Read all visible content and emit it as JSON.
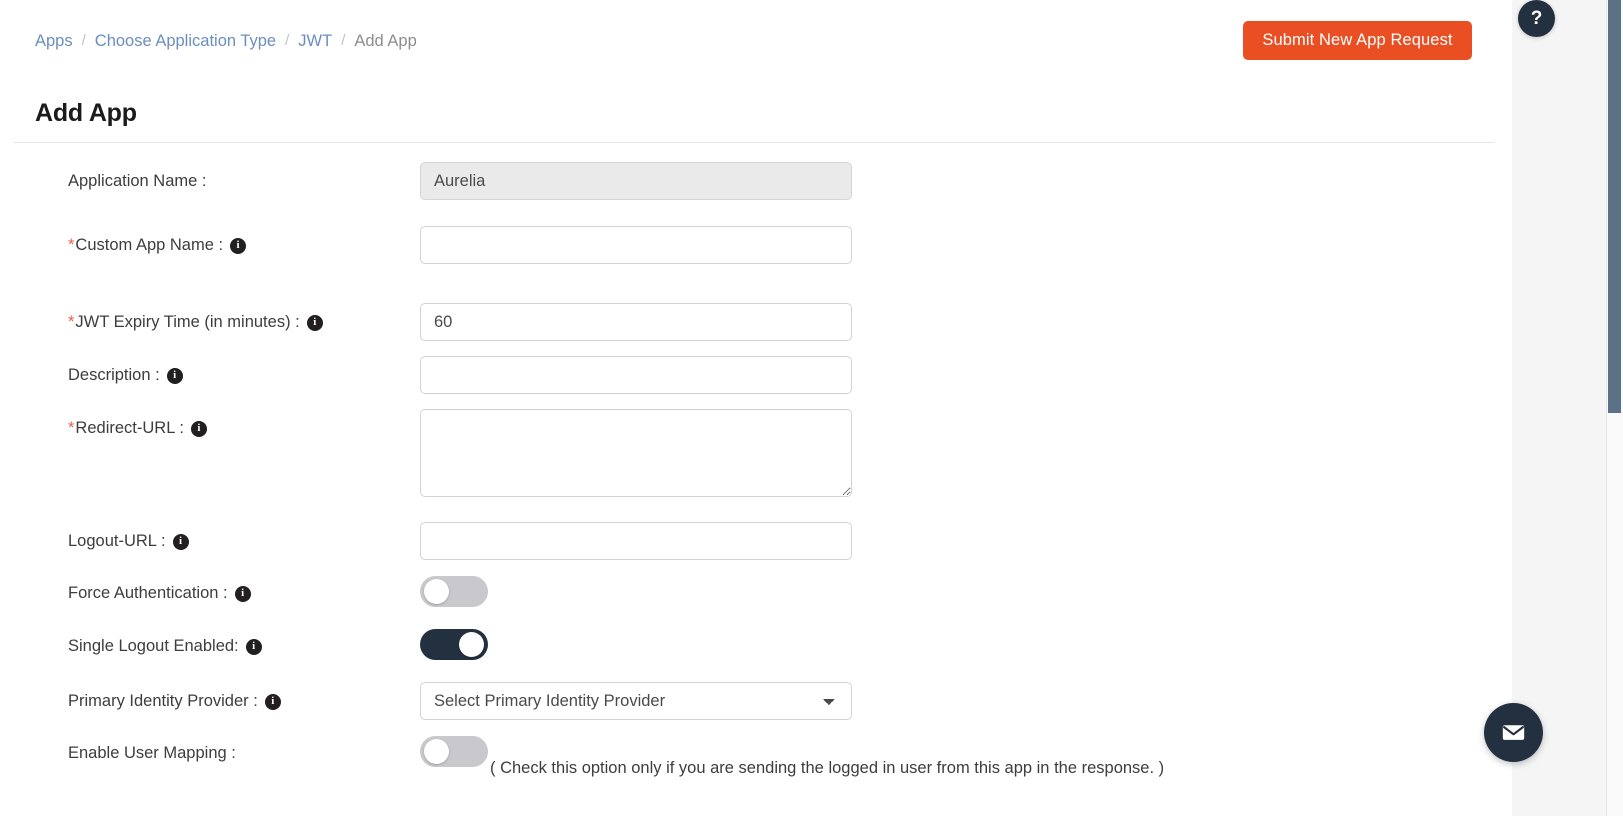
{
  "breadcrumb": {
    "items": [
      {
        "label": "Apps",
        "current": false
      },
      {
        "label": "Choose Application Type",
        "current": false
      },
      {
        "label": "JWT",
        "current": false
      },
      {
        "label": "Add App",
        "current": true
      }
    ],
    "separator": "/"
  },
  "header": {
    "title": "Add App",
    "submit_button": "Submit New App Request"
  },
  "form": {
    "fields": [
      {
        "label": "Application Name :",
        "required": false,
        "has_info_icon": false,
        "type": "text",
        "value": "Aurelia",
        "disabled": true
      },
      {
        "label": "Custom App Name :",
        "required": true,
        "has_info_icon": true,
        "type": "text",
        "value": "",
        "disabled": false
      },
      {
        "label": "JWT Expiry Time (in minutes) :",
        "required": true,
        "has_info_icon": true,
        "type": "text",
        "value": "60",
        "disabled": false
      },
      {
        "label": "Description :",
        "required": false,
        "has_info_icon": true,
        "type": "text",
        "value": "",
        "disabled": false
      },
      {
        "label": "Redirect-URL :",
        "required": true,
        "has_info_icon": true,
        "type": "textarea",
        "value": "",
        "disabled": false
      },
      {
        "label": "Logout-URL :",
        "required": false,
        "has_info_icon": true,
        "type": "text",
        "value": "",
        "disabled": false
      },
      {
        "label": "Force Authentication :",
        "required": false,
        "has_info_icon": true,
        "type": "toggle",
        "enabled": false
      },
      {
        "label": "Single Logout Enabled:",
        "required": false,
        "has_info_icon": true,
        "type": "toggle",
        "enabled": true
      },
      {
        "label": "Primary Identity Provider :",
        "required": false,
        "has_info_icon": true,
        "type": "select",
        "selected": "Select Primary Identity Provider"
      },
      {
        "label": "Enable User Mapping :",
        "required": false,
        "has_info_icon": false,
        "type": "toggle",
        "enabled": false,
        "helper": "( Check this option only if you are sending the logged in user from this app in the response. )"
      }
    ],
    "info_icon_glyph": "i"
  },
  "widgets": {
    "help_label": "?",
    "chat_icon": "envelope-icon"
  },
  "colors": {
    "accent": "#ea4f23",
    "toggle_on": "#22303f",
    "toggle_off": "#c9c9cd",
    "required": "#e8604c",
    "link": "#6c8ebf",
    "scrollbar": "#5b7286"
  }
}
